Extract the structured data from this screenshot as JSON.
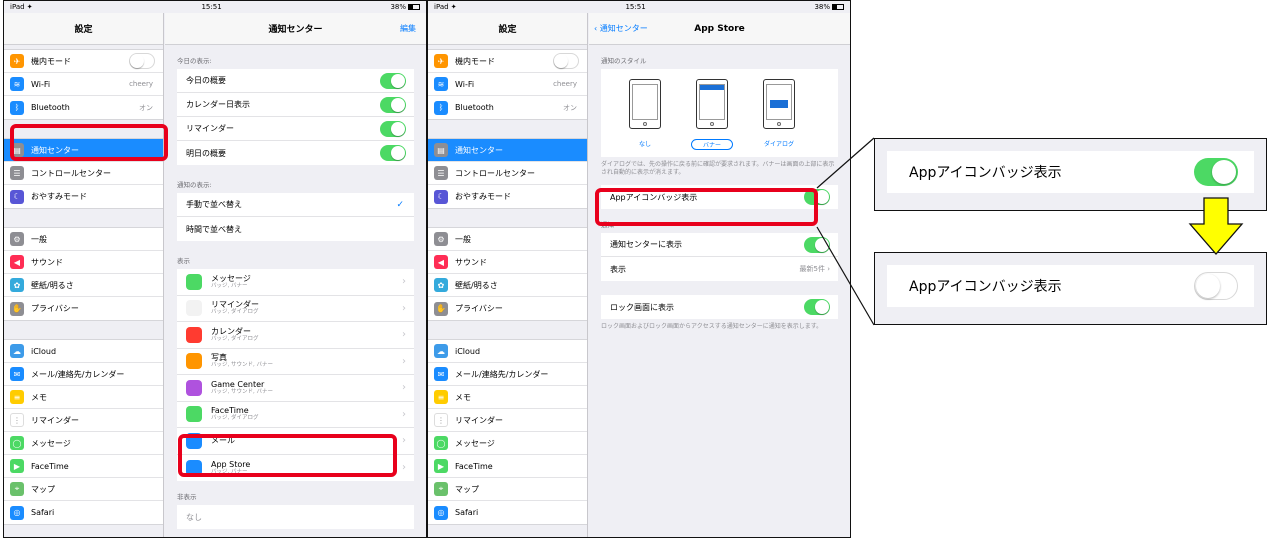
{
  "status": {
    "device": "iPad ✦",
    "time": "15:51",
    "battery": "38%"
  },
  "left_panel": {
    "title": "設定",
    "group1": [
      {
        "label": "機内モード",
        "value": "",
        "icon": "airplane-icon",
        "color": "#ff9500",
        "glyph": "✈"
      },
      {
        "label": "Wi-Fi",
        "value": "cheery",
        "icon": "wifi-icon",
        "color": "#1a8cff",
        "glyph": "≋"
      },
      {
        "label": "Bluetooth",
        "value": "オン",
        "icon": "bluetooth-icon",
        "color": "#1a8cff",
        "glyph": "ᛒ"
      }
    ],
    "group2": [
      {
        "label": "通知センター",
        "icon": "notification-center-icon",
        "color": "#8e8e93",
        "glyph": "▤"
      },
      {
        "label": "コントロールセンター",
        "icon": "control-center-icon",
        "color": "#8e8e93",
        "glyph": "☰"
      },
      {
        "label": "おやすみモード",
        "icon": "moon-icon",
        "color": "#5856d6",
        "glyph": "☾"
      }
    ],
    "group3": [
      {
        "label": "一般",
        "icon": "gear-icon",
        "color": "#8e8e93",
        "glyph": "⚙"
      },
      {
        "label": "サウンド",
        "icon": "sound-icon",
        "color": "#ff2d55",
        "glyph": "◀"
      },
      {
        "label": "壁紙/明るさ",
        "icon": "wallpaper-icon",
        "color": "#34aadc",
        "glyph": "✿"
      },
      {
        "label": "プライバシー",
        "icon": "privacy-hand-icon",
        "color": "#8e8e93",
        "glyph": "✋"
      }
    ],
    "group4": [
      {
        "label": "iCloud",
        "icon": "icloud-icon",
        "color": "#3d9be9",
        "glyph": "☁"
      },
      {
        "label": "メール/連絡先/カレンダー",
        "icon": "mail-icon",
        "color": "#1a8cff",
        "glyph": "✉"
      },
      {
        "label": "メモ",
        "icon": "notes-icon",
        "color": "#ffcc00",
        "glyph": "≡"
      },
      {
        "label": "リマインダー",
        "icon": "reminders-icon",
        "color": "#ffffff",
        "glyph": "⋮"
      },
      {
        "label": "メッセージ",
        "icon": "messages-icon",
        "color": "#4cd964",
        "glyph": "◯"
      },
      {
        "label": "FaceTime",
        "icon": "facetime-icon",
        "color": "#4cd964",
        "glyph": "▶"
      },
      {
        "label": "マップ",
        "icon": "maps-icon",
        "color": "#6ac16b",
        "glyph": "⌖"
      },
      {
        "label": "Safari",
        "icon": "safari-icon",
        "color": "#1a8cff",
        "glyph": "◎"
      }
    ]
  },
  "notification_center": {
    "title": "通知センター",
    "edit": "編集",
    "today_header": "今日の表示:",
    "today_items": [
      {
        "label": "今日の概要"
      },
      {
        "label": "カレンダー日表示"
      },
      {
        "label": "リマインダー"
      },
      {
        "label": "明日の概要"
      }
    ],
    "sort_header": "通知の表示:",
    "sort_items": [
      {
        "label": "手動で並べ替え",
        "checked": true
      },
      {
        "label": "時間で並べ替え",
        "checked": false
      }
    ],
    "show_header": "表示",
    "apps": [
      {
        "name": "メッセージ",
        "sub": "バッジ, バナー",
        "icon": "messages-icon",
        "color": "#4cd964"
      },
      {
        "name": "リマインダー",
        "sub": "バッジ, ダイアログ",
        "icon": "reminders-icon",
        "color": "#f2f2f2"
      },
      {
        "name": "カレンダー",
        "sub": "バッジ, ダイアログ",
        "icon": "calendar-icon",
        "color": "#ff3b30"
      },
      {
        "name": "写真",
        "sub": "バッジ, サウンド, バナー",
        "icon": "photos-icon",
        "color": "#ff9500"
      },
      {
        "name": "Game Center",
        "sub": "バッジ, サウンド, バナー",
        "icon": "game-center-icon",
        "color": "#af52de"
      },
      {
        "name": "FaceTime",
        "sub": "バッジ, ダイアログ",
        "icon": "facetime-icon",
        "color": "#4cd964"
      },
      {
        "name": "メール",
        "sub": "",
        "icon": "mail-icon",
        "color": "#1a8cff"
      },
      {
        "name": "App Store",
        "sub": "バッジ, バナー",
        "icon": "app-store-icon",
        "color": "#1a8cff"
      }
    ],
    "hidden_header": "非表示",
    "hidden_none": "なし"
  },
  "app_store_settings": {
    "back": "通知センター",
    "title": "App Store",
    "style_header": "通知のスタイル",
    "styles": [
      "なし",
      "バナー",
      "ダイアログ"
    ],
    "style_note": "ダイアログでは、先の操作に戻る前に確認が要求されます。バナーは画面の上部に表示され自動的に表示が消えます。",
    "badge_label": "Appアイコンバッジ表示",
    "notify_header": "通知",
    "show_in_nc": "通知センターに表示",
    "display_label": "表示",
    "display_value": "最新5件",
    "lock_label": "ロック画面に表示",
    "lock_note": "ロック画面およびロック画面からアクセスする通知センターに通知を表示します。"
  },
  "zoom": {
    "before_label": "Appアイコンバッジ表示",
    "after_label": "Appアイコンバッジ表示",
    "arrow_color": "#ffff00",
    "highlight_color": "#e8001c"
  }
}
